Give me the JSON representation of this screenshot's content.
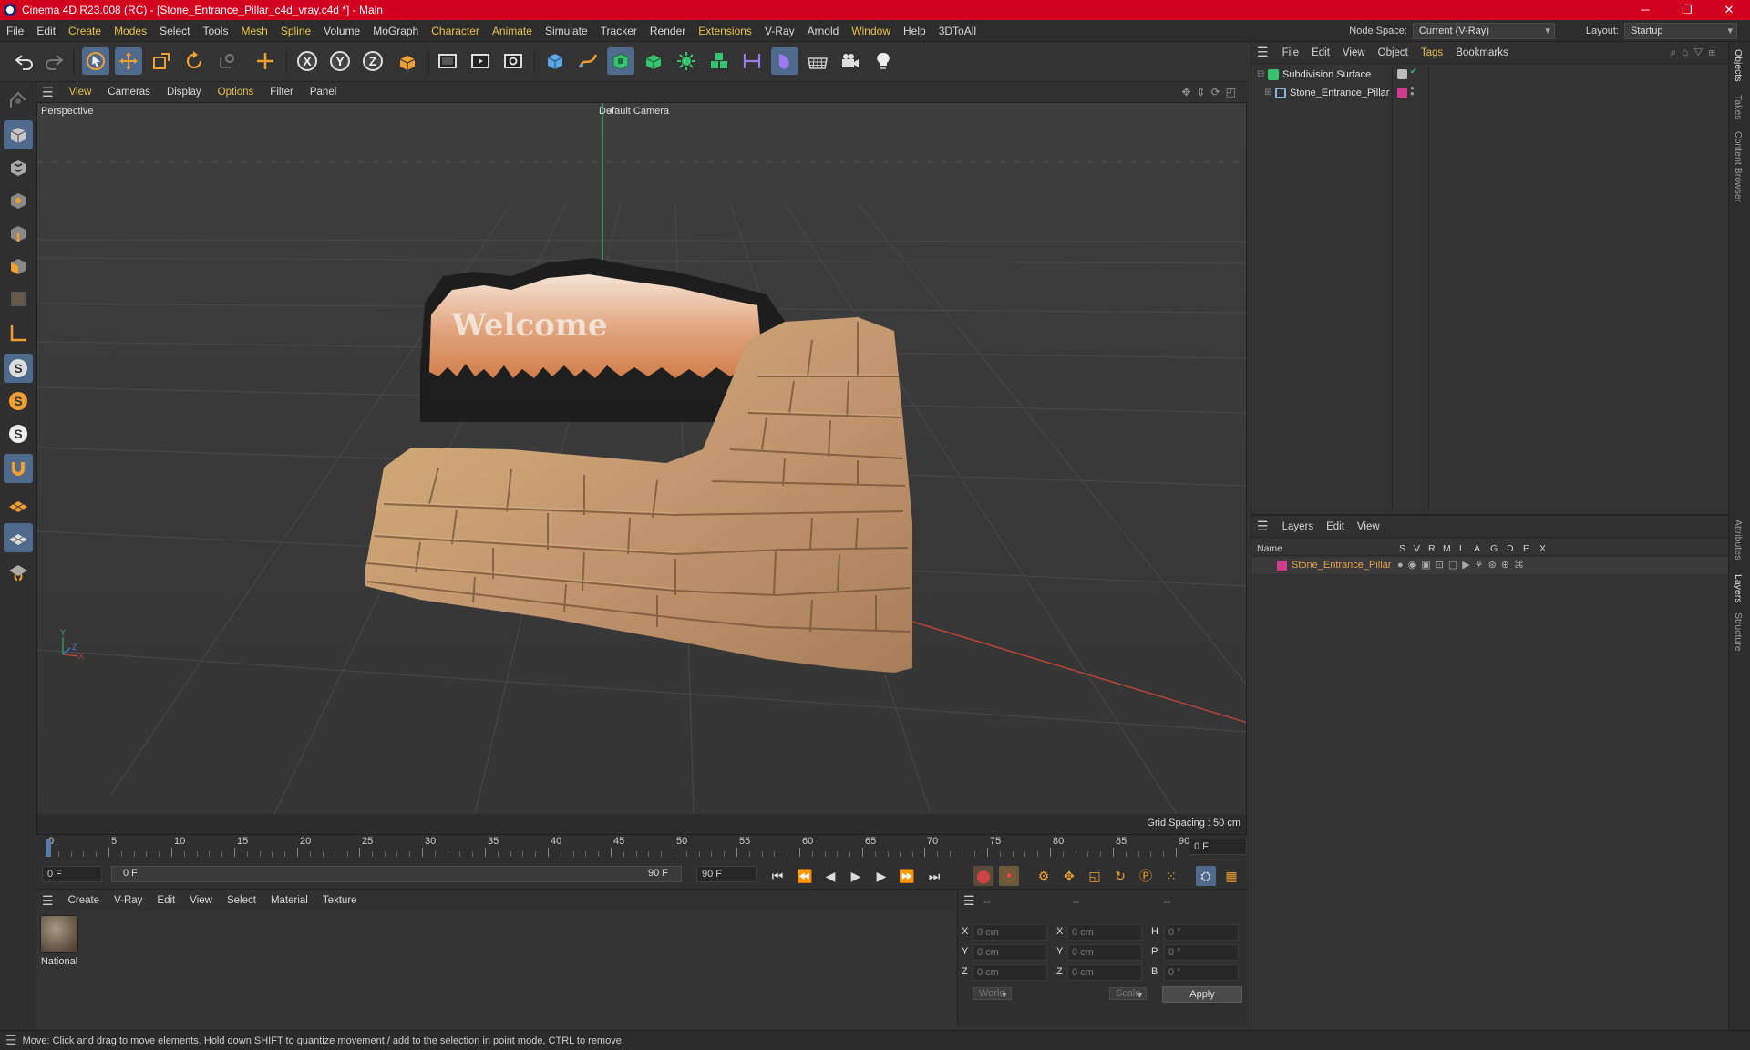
{
  "title_bar": {
    "text": "Cinema 4D R23.008 (RC) - [Stone_Entrance_Pillar_c4d_vray.c4d *] - Main"
  },
  "menu": {
    "items": [
      "File",
      "Edit",
      "Create",
      "Modes",
      "Select",
      "Tools",
      "Mesh",
      "Spline",
      "Volume",
      "MoGraph",
      "Character",
      "Animate",
      "Simulate",
      "Tracker",
      "Render",
      "Extensions",
      "V-Ray",
      "Arnold",
      "Window",
      "Help",
      "3DToAll"
    ],
    "node_space_label": "Node Space:",
    "node_space_value": "Current (V-Ray)",
    "layout_label": "Layout:",
    "layout_value": "Startup"
  },
  "toolbar": {
    "icons": [
      "undo-icon",
      "redo-icon",
      "select-icon",
      "move-icon",
      "scale-icon",
      "rotate-icon",
      "recent-tool-icon",
      "add-icon",
      "x-axis-icon",
      "y-axis-icon",
      "z-axis-icon",
      "coordinate-system-icon",
      "render-region-icon",
      "render-view-icon",
      "render-settings-icon",
      "cube-icon",
      "pen-icon",
      "subdivision-icon",
      "extrude-icon",
      "cloner-icon",
      "array-icon",
      "symmetry-icon",
      "deformer-icon",
      "floor-icon",
      "camera-icon",
      "light-icon"
    ]
  },
  "viewport": {
    "menu": [
      "View",
      "Cameras",
      "Display",
      "Options",
      "Filter",
      "Panel"
    ],
    "view_name": "Perspective",
    "camera": "Default Camera",
    "grid_spacing": "Grid Spacing : 50 cm",
    "sign_text": "Welcome",
    "axis_x": "X",
    "axis_y": "Y",
    "axis_z": "Z"
  },
  "timeline": {
    "ticks": [
      "0",
      "5",
      "10",
      "15",
      "20",
      "25",
      "30",
      "35",
      "40",
      "45",
      "50",
      "55",
      "60",
      "65",
      "70",
      "75",
      "80",
      "85",
      "90"
    ],
    "current_frame_right": "0 F",
    "start": "0 F",
    "range_start": "0 F",
    "range_end": "90 F",
    "end": "90 F"
  },
  "materials": {
    "menu": [
      "Create",
      "V-Ray",
      "Edit",
      "View",
      "Select",
      "Material",
      "Texture"
    ],
    "items": [
      {
        "name": "National"
      }
    ]
  },
  "coordinates": {
    "headers": [
      "--",
      "--",
      "--"
    ],
    "rows": [
      {
        "a": "X",
        "av": "0 cm",
        "b": "X",
        "bv": "0 cm",
        "c": "H",
        "cv": "0 °"
      },
      {
        "a": "Y",
        "av": "0 cm",
        "b": "Y",
        "bv": "0 cm",
        "c": "P",
        "cv": "0 °"
      },
      {
        "a": "Z",
        "av": "0 cm",
        "b": "Z",
        "bv": "0 cm",
        "c": "B",
        "cv": "0 °"
      }
    ],
    "space": "World",
    "mode": "Scale",
    "apply": "Apply"
  },
  "objects": {
    "menu": [
      "File",
      "Edit",
      "View",
      "Object",
      "Tags",
      "Bookmarks"
    ],
    "tree": [
      {
        "name": "Subdivision Surface"
      },
      {
        "name": "Stone_Entrance_Pillar"
      }
    ]
  },
  "layers": {
    "menu": [
      "Layers",
      "Edit",
      "View"
    ],
    "columns": [
      "Name",
      "S",
      "V",
      "R",
      "M",
      "L",
      "A",
      "G",
      "D",
      "E",
      "X"
    ],
    "rows": [
      {
        "name": "Stone_Entrance_Pillar",
        "color": "#d13d8e"
      }
    ]
  },
  "side_tabs": [
    "Objects",
    "Takes",
    "Content Browser",
    "Attributes",
    "Layers",
    "Structure"
  ],
  "status": {
    "text": "Move: Click and drag to move elements. Hold down SHIFT to quantize movement / add to the selection in point mode, CTRL to remove."
  },
  "colors": {
    "accent": "#e6c24a",
    "title_bar": "#d2001e",
    "selection": "#4f6a8c"
  }
}
